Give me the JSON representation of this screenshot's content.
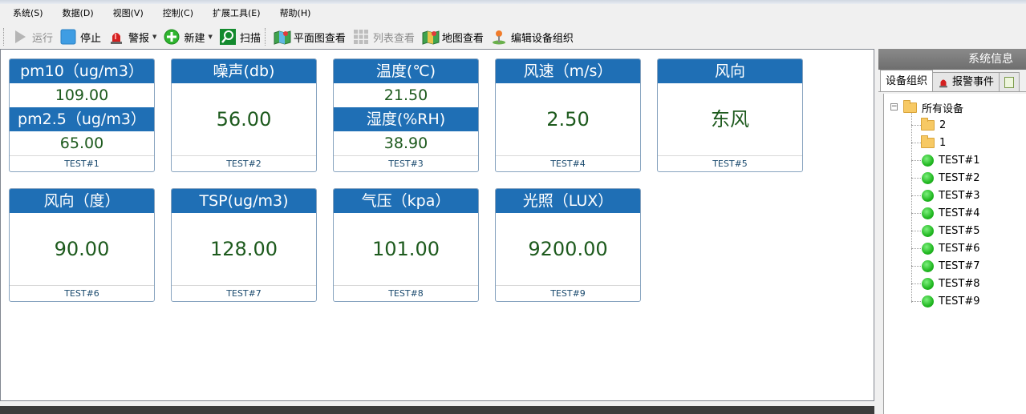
{
  "menu": [
    "系统(S)",
    "数据(D)",
    "视图(V)",
    "控制(C)",
    "扩展工具(E)",
    "帮助(H)"
  ],
  "toolbar": {
    "run": "运行",
    "stop": "停止",
    "alarm": "警报",
    "new": "新建",
    "scan": "扫描",
    "plan_view": "平面图查看",
    "list_view": "列表查看",
    "map_view": "地图查看",
    "edit_org": "编辑设备组织"
  },
  "cards": [
    {
      "title1": "pm10（ug/m3）",
      "value1": "109.00",
      "title2": "pm2.5（ug/m3）",
      "value2": "65.00",
      "device": "TEST#1"
    },
    {
      "title": "噪声(db)",
      "value": "56.00",
      "device": "TEST#2"
    },
    {
      "title1": "温度(℃)",
      "value1": "21.50",
      "title2": "湿度(%RH)",
      "value2": "38.90",
      "device": "TEST#3"
    },
    {
      "title": "风速（m/s）",
      "value": "2.50",
      "device": "TEST#4"
    },
    {
      "title": "风向",
      "value": "东风",
      "device": "TEST#5"
    },
    {
      "title": "风向（度）",
      "value": "90.00",
      "device": "TEST#6"
    },
    {
      "title": "TSP(ug/m3)",
      "value": "128.00",
      "device": "TEST#7"
    },
    {
      "title": "气压（kpa）",
      "value": "101.00",
      "device": "TEST#8"
    },
    {
      "title": "光照（LUX）",
      "value": "9200.00",
      "device": "TEST#9"
    }
  ],
  "right_panel": {
    "title": "系统信息",
    "tabs": [
      "设备组织",
      "报警事件"
    ],
    "tree": {
      "root": "所有设备",
      "folders": [
        "2",
        "1"
      ],
      "devices": [
        "TEST#1",
        "TEST#2",
        "TEST#3",
        "TEST#4",
        "TEST#5",
        "TEST#6",
        "TEST#7",
        "TEST#8",
        "TEST#9"
      ]
    }
  },
  "colors": {
    "card_header": "#1f6fb5",
    "value_text": "#1d5a1d",
    "status_online": "#21b821"
  }
}
